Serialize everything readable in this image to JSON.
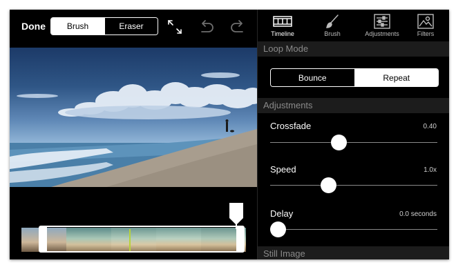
{
  "toolbar": {
    "done_label": "Done",
    "mode_options": [
      {
        "label": "Brush",
        "selected": true
      },
      {
        "label": "Eraser",
        "selected": false
      }
    ],
    "icons": [
      "expand-icon",
      "undo-icon",
      "redo-icon"
    ]
  },
  "tabs": [
    {
      "label": "Timeline",
      "icon": "timeline-icon",
      "active": true
    },
    {
      "label": "Brush",
      "icon": "brush-icon",
      "active": false
    },
    {
      "label": "Adjustments",
      "icon": "adjustments-icon",
      "active": false
    },
    {
      "label": "Filters",
      "icon": "filters-icon",
      "active": false
    }
  ],
  "loop_mode": {
    "header": "Loop Mode",
    "options": [
      {
        "label": "Bounce",
        "selected": false
      },
      {
        "label": "Repeat",
        "selected": true
      }
    ]
  },
  "adjustments": {
    "header": "Adjustments",
    "crossfade": {
      "label": "Crossfade",
      "value": "0.40",
      "level": 0.4
    },
    "speed": {
      "label": "Speed",
      "value": "1.0x",
      "level": 0.33
    },
    "delay": {
      "label": "Delay",
      "value": "0.0 seconds",
      "level": 0.0
    }
  },
  "still_image": {
    "header": "Still Image"
  },
  "colors": {
    "accent": "#ffffff",
    "playhead": "#b8d23a",
    "panel_header_bg": "#1c1c1c"
  }
}
